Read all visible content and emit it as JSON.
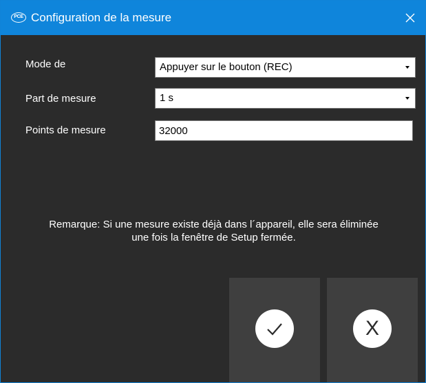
{
  "window": {
    "title": "Configuration de la mesure",
    "app_icon_text": "PCE",
    "close_icon": "close-icon"
  },
  "form": {
    "mode": {
      "label": "Mode de",
      "value": "Appuyer sur le bouton (REC)"
    },
    "rate": {
      "label": "Part de mesure",
      "value": "1 s"
    },
    "points": {
      "label": "Points de mesure",
      "value": "32000"
    }
  },
  "remark": {
    "line1": "Remarque: Si une mesure existe déjà dans l´appareil, elle sera éliminée",
    "line2": "une fois la fenêtre de Setup fermée."
  },
  "buttons": {
    "confirm_icon": "checkmark-icon",
    "cancel_label": "X"
  },
  "colors": {
    "titlebar": "#0f85db",
    "background": "#2b2b2b",
    "button_tile": "#3f3f3f"
  }
}
